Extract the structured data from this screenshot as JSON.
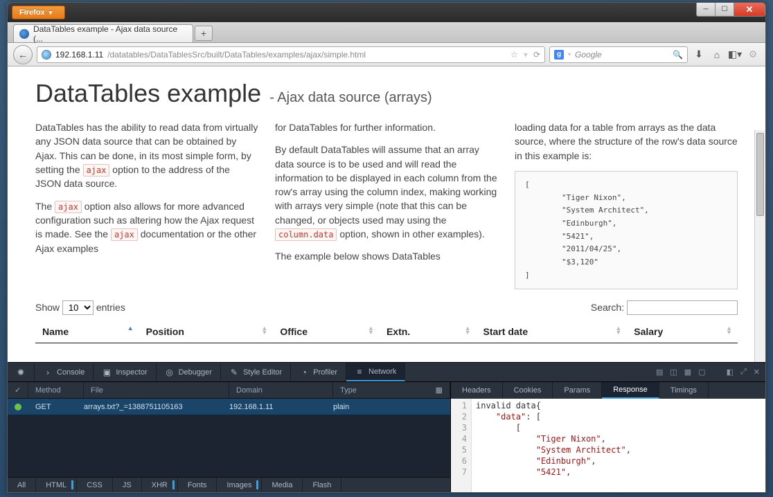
{
  "browser": {
    "name": "Firefox",
    "tab_title": "DataTables example - Ajax data source (...",
    "url_host": "192.168.1.11",
    "url_path": "/datatables/DataTablesSrc/built/DataTables/examples/ajax/simple.html",
    "search_placeholder": "Google"
  },
  "page": {
    "title": "DataTables example",
    "subtitle": "- Ajax data source (arrays)",
    "col1_p1a": "DataTables has the ability to read data from virtually any JSON data source that can be obtained by Ajax. This can be done, in its most simple form, by setting the ",
    "col1_p1b": " option to the address of the JSON data source.",
    "col1_p2a": "The ",
    "col1_p2b": " option also allows for more advanced configuration such as altering how the Ajax request is made. See the ",
    "col1_p2c": " documentation or the other Ajax examples",
    "col2_p1": "for DataTables for further information.",
    "col2_p2a": "By default DataTables will assume that an array data source is to be used and will read the information to be displayed in each column from the row's array using the column index, making working with arrays very simple (note that this can be changed, or objects used may using the ",
    "col2_p2b": " option, shown in other examples).",
    "col2_p3": "The example below shows DataTables",
    "col3_p1": "loading data for a table from arrays as the data source, where the structure of the row's data source in this example is:",
    "code_ajax": "ajax",
    "code_columndata": "column.data",
    "json_example": "[\n        \"Tiger Nixon\",\n        \"System Architect\",\n        \"Edinburgh\",\n        \"5421\",\n        \"2011/04/25\",\n        \"$3,120\"\n]",
    "show_label": "Show",
    "show_value": "10",
    "entries_label": "entries",
    "search_label": "Search:",
    "columns": [
      "Name",
      "Position",
      "Office",
      "Extn.",
      "Start date",
      "Salary"
    ]
  },
  "devtools": {
    "tabs": [
      "Console",
      "Inspector",
      "Debugger",
      "Style Editor",
      "Profiler",
      "Network"
    ],
    "net_headers": [
      "✓",
      "Method",
      "File",
      "Domain",
      "Type"
    ],
    "net_row": {
      "method": "GET",
      "file": "arrays.txt?_=1388751105163",
      "domain": "192.168.1.11",
      "type": "plain"
    },
    "filters": [
      "All",
      "HTML",
      "CSS",
      "JS",
      "XHR",
      "Fonts",
      "Images",
      "Media",
      "Flash"
    ],
    "resp_tabs": [
      "Headers",
      "Cookies",
      "Params",
      "Response",
      "Timings"
    ],
    "response_lines": [
      "invalid data{",
      "    \"data\": [",
      "        [",
      "            \"Tiger Nixon\",",
      "            \"System Architect\",",
      "            \"Edinburgh\",",
      "            \"5421\","
    ]
  }
}
